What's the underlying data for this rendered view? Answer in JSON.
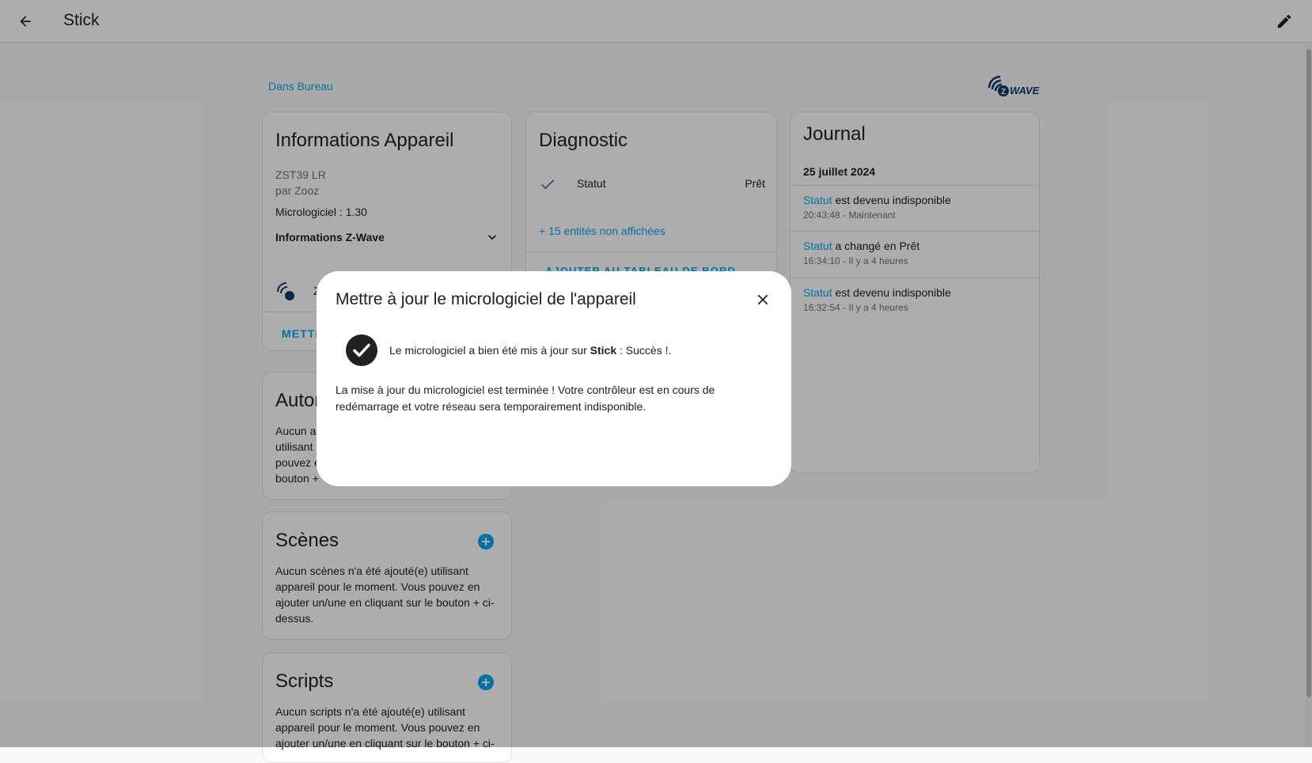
{
  "header": {
    "title": "Stick",
    "back_icon": "arrow-left-icon",
    "edit_icon": "pencil-icon"
  },
  "area_link": "Dans Bureau",
  "brand": {
    "logo_text": "WAVE",
    "logo_letter": "Z",
    "color": "#0c3a6b"
  },
  "device_info": {
    "title": "Informations Appareil",
    "model": "ZST39 LR",
    "manufacturer": "par Zooz",
    "firmware": "Micrologiciel : 1.30",
    "zwave_info_label": "Informations Z-Wave",
    "zwave_row_text": "Z",
    "action": "METTR"
  },
  "diagnostic": {
    "title": "Diagnostic",
    "entity_name": "Statut",
    "entity_state": "Prêt",
    "hidden_entities": "+ 15 entités non affichées",
    "action": "AJOUTER AU TABLEAU DE BORD"
  },
  "automations": {
    "title": "Autor",
    "lines": [
      "Aucun a",
      "utilisant",
      "pouvez e",
      "bouton +"
    ]
  },
  "scenes": {
    "title": "Scènes",
    "lines": [
      "Aucun scènes n'a été ajouté(e) utilisant",
      "appareil pour le moment. Vous pouvez en",
      "ajouter un/une en cliquant sur le bouton + ci-",
      "dessus."
    ]
  },
  "scripts": {
    "title": "Scripts",
    "lines": [
      "Aucun scripts n'a été ajouté(e) utilisant",
      "appareil pour le moment. Vous pouvez en",
      "ajouter un/une en cliquant sur le bouton + ci-"
    ]
  },
  "logbook": {
    "title": "Journal",
    "date": "25 juillet 2024",
    "entries": [
      {
        "entity": "Statut",
        "message": " est devenu indisponible",
        "time": "20:43:48 - Maintenant"
      },
      {
        "entity": "Statut",
        "message": " a changé en Prêt",
        "time": "16:34:10 - Il y a 4 heures"
      },
      {
        "entity": "Statut",
        "message": " est devenu indisponible",
        "time": "16:32:54 - Il y a 4 heures"
      }
    ]
  },
  "dialog": {
    "title": "Mettre à jour le micrologiciel de l'appareil",
    "success_prefix": "Le micrologiciel a bien été mis à jour sur ",
    "device_name": "Stick",
    "success_suffix": " : Succès !.",
    "body": "La mise à jour du micrologiciel est terminée ! Votre contrôleur est en cours de redémarrage et votre réseau sera temporairement indisponible."
  },
  "colors": {
    "primary": "#03a9f4",
    "text": "#212121",
    "secondary_text": "#727272"
  }
}
